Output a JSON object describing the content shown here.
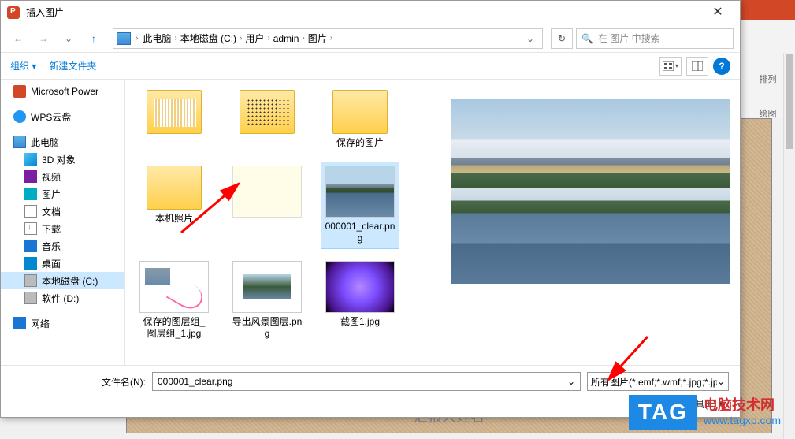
{
  "dialog": {
    "title": "插入图片",
    "close": "✕"
  },
  "nav": {
    "back": "←",
    "forward": "→",
    "up": "↑",
    "refresh": "↻",
    "drop": "⌄"
  },
  "breadcrumb": {
    "items": [
      "此电脑",
      "本地磁盘 (C:)",
      "用户",
      "admin",
      "图片"
    ],
    "sep": "›"
  },
  "search": {
    "placeholder": "在 图片 中搜索",
    "icon": "🔍"
  },
  "toolbar": {
    "organize": "组织 ▾",
    "newfolder": "新建文件夹",
    "help": "?"
  },
  "sidebar": {
    "items": [
      {
        "label": "Microsoft Power",
        "cls": "ic-ppt",
        "indent": 0
      },
      {
        "label": "WPS云盘",
        "cls": "ic-wps",
        "indent": 0
      },
      {
        "label": "此电脑",
        "cls": "ic-pc",
        "indent": 0
      },
      {
        "label": "3D 对象",
        "cls": "ic-3d",
        "indent": 1
      },
      {
        "label": "视频",
        "cls": "ic-video",
        "indent": 1
      },
      {
        "label": "图片",
        "cls": "ic-pic",
        "indent": 1
      },
      {
        "label": "文档",
        "cls": "ic-doc",
        "indent": 1
      },
      {
        "label": "下载",
        "cls": "ic-dl",
        "indent": 1
      },
      {
        "label": "音乐",
        "cls": "ic-music",
        "indent": 1
      },
      {
        "label": "桌面",
        "cls": "ic-desk",
        "indent": 1
      },
      {
        "label": "本地磁盘 (C:)",
        "cls": "ic-disk",
        "indent": 1,
        "selected": true
      },
      {
        "label": "软件 (D:)",
        "cls": "ic-disk",
        "indent": 1
      },
      {
        "label": "网络",
        "cls": "ic-net",
        "indent": 0
      }
    ]
  },
  "files": {
    "items": [
      {
        "label": "",
        "type": "folder-striped"
      },
      {
        "label": "",
        "type": "folder-dotted"
      },
      {
        "label": "保存的图片",
        "type": "folder"
      },
      {
        "label": "本机照片",
        "type": "folder"
      },
      {
        "label": "",
        "type": "blank"
      },
      {
        "label": "000001_clear.png",
        "type": "lake",
        "selected": true
      },
      {
        "label": "保存的图层组_图层组_1.jpg",
        "type": "pink"
      },
      {
        "label": "导出风景图层.png",
        "type": "lake2"
      },
      {
        "label": "截图1.jpg",
        "type": "purple"
      }
    ]
  },
  "footer": {
    "filename_label": "文件名(N):",
    "filename_value": "000001_clear.png",
    "filetype_value": "所有图片(*.emf;*.wmf;*.jpg;*.jp",
    "tools": "工具(L)",
    "drop": "▾",
    "dd": "⌄"
  },
  "ppt": {
    "arrange": "排列",
    "drawing": "绘图",
    "placeholder": "汇报人姓名"
  },
  "watermark": {
    "tag": "TAG",
    "line1": "电脑技术网",
    "line2": "www.tagxp.com"
  }
}
